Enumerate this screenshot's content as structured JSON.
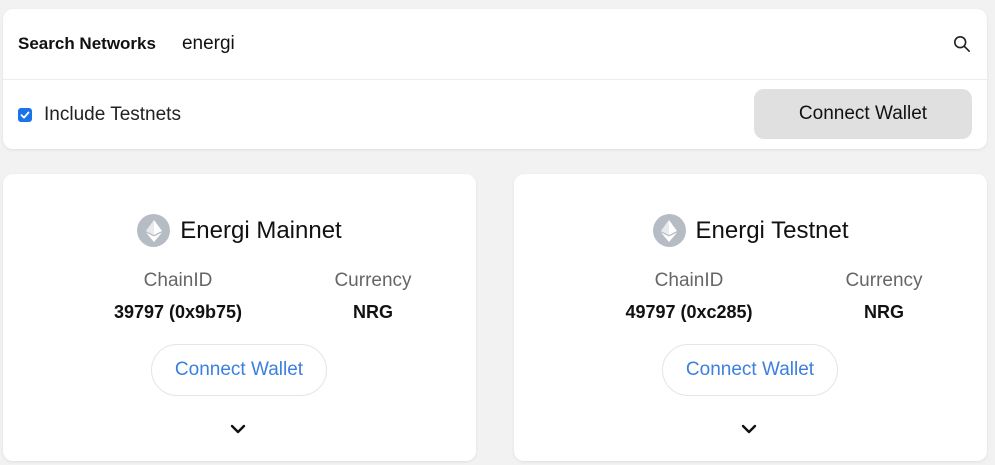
{
  "search": {
    "label": "Search Networks",
    "value": "energi",
    "icon": "search-icon"
  },
  "options": {
    "include_testnets_label": "Include Testnets",
    "include_testnets_checked": true,
    "connect_wallet_label": "Connect Wallet"
  },
  "networks": [
    {
      "name": "Energi Mainnet",
      "chain_id_label": "ChainID",
      "chain_id": "39797 (0x9b75)",
      "currency_label": "Currency",
      "currency": "NRG",
      "connect_label": "Connect Wallet",
      "icon": "ethereum-icon"
    },
    {
      "name": "Energi Testnet",
      "chain_id_label": "ChainID",
      "chain_id": "49797 (0xc285)",
      "currency_label": "Currency",
      "currency": "NRG",
      "connect_label": "Connect Wallet",
      "icon": "ethereum-icon"
    }
  ],
  "colors": {
    "accent": "#3b7fe0",
    "checkbox": "#1a73e8",
    "background": "#f2f2f2",
    "button_gray": "#e0e0e0"
  }
}
